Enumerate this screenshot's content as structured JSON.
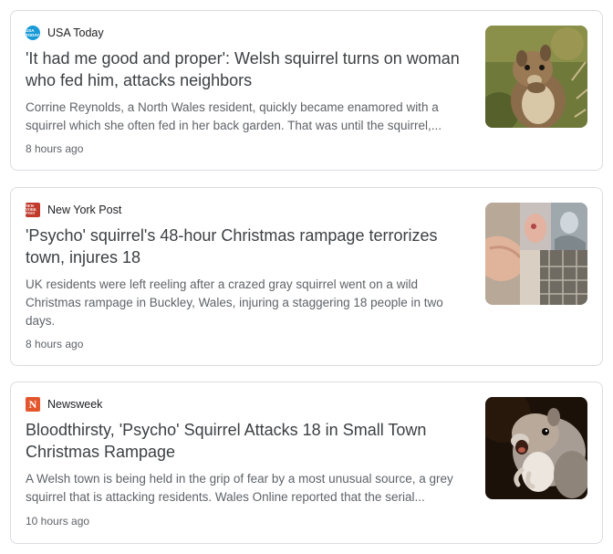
{
  "articles": [
    {
      "source": "USA Today",
      "source_icon": "usa-today-icon",
      "source_icon_text": "USA TODAY",
      "headline": "'It had me good and proper': Welsh squirrel turns on woman who fed him, attacks neighbors",
      "snippet": "Corrine Reynolds, a North Wales resident, quickly became enamored with a squirrel which she often fed in her back garden. That was until the squirrel,...",
      "time": "8 hours ago",
      "thumbnail": "squirrel-eating-photo"
    },
    {
      "source": "New York Post",
      "source_icon": "new-york-post-icon",
      "source_icon_text": "NEW YORK POST",
      "headline": "'Psycho' squirrel's 48-hour Christmas rampage terrorizes town, injures 18",
      "snippet": "UK residents were left reeling after a crazed gray squirrel went on a wild Christmas rampage in Buckley, Wales, injuring a staggering 18 people in two days.",
      "time": "8 hours ago",
      "thumbnail": "injury-collage-photo"
    },
    {
      "source": "Newsweek",
      "source_icon": "newsweek-icon",
      "source_icon_text": "N",
      "headline": "Bloodthirsty, 'Psycho' Squirrel Attacks 18 in Small Town Christmas Rampage",
      "snippet": "A Welsh town is being held in the grip of fear by a most unusual source, a grey squirrel that is attacking residents. Wales Online reported that the serial...",
      "time": "10 hours ago",
      "thumbnail": "screaming-squirrel-photo"
    }
  ],
  "colors": {
    "card_border": "#dadce0",
    "headline": "#3c4043",
    "snippet": "#5f6368",
    "usa_today_blue": "#1a9bd7",
    "nyp_red": "#c0392b",
    "newsweek_orange": "#e4572e"
  }
}
